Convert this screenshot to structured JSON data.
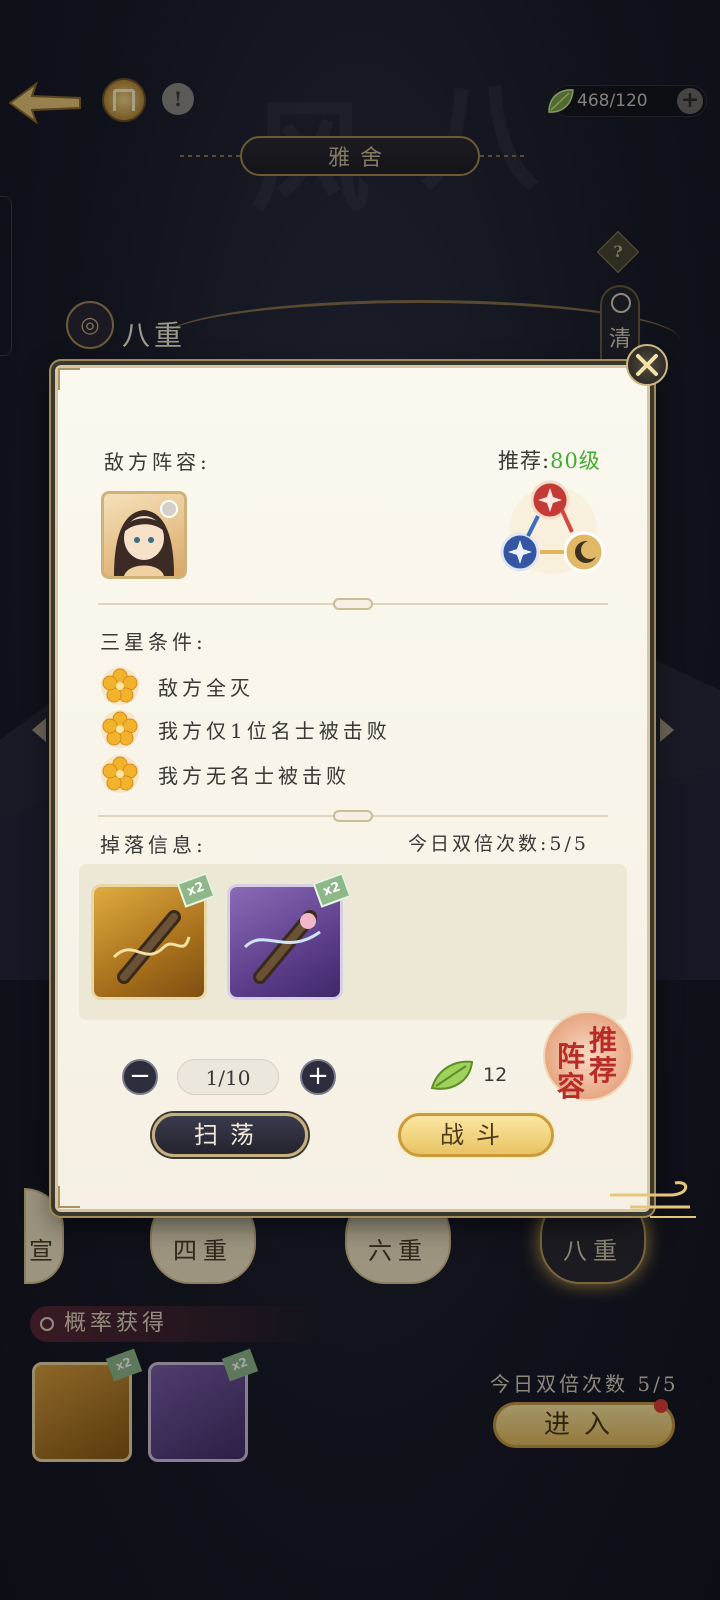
{
  "header": {
    "title": "雅舍",
    "stamina": "468/120",
    "help_icon": "?",
    "alert_icon": "!"
  },
  "side": {
    "clear_tab_label": "清"
  },
  "stage": {
    "name": "八重"
  },
  "modal": {
    "enemy_label": "敌方阵容:",
    "recommend_prefix": "推荐:",
    "recommend_level": "80级",
    "three_star_label": "三星条件:",
    "conditions": [
      "敌方全灭",
      "我方仅1位名士被击败",
      "我方无名士被击败"
    ],
    "drop_label": "掉落信息:",
    "double_label": "今日双倍次数:5/5",
    "drops": [
      {
        "name": "gold-guqin-item",
        "badge": "x2"
      },
      {
        "name": "purple-guqin-item",
        "badge": "x2"
      }
    ],
    "stepper_value": "1/10",
    "cost": "12",
    "rec_lineup": [
      "推",
      "荐",
      "阵",
      "容"
    ],
    "sweep_label": "扫荡",
    "fight_label": "战斗"
  },
  "background": {
    "tiers": [
      "宣",
      "四重",
      "六重",
      "八重"
    ],
    "prob_label": "概率获得",
    "items": [
      {
        "badge": "x2"
      },
      {
        "badge": "x2"
      }
    ],
    "double_label": "今日双倍次数 5/5",
    "enter_label": "进入"
  },
  "colors": {
    "level_green": "#3fae2f",
    "gold_accent": "#c7b07c",
    "panel_bg": "#f5f0e3"
  }
}
